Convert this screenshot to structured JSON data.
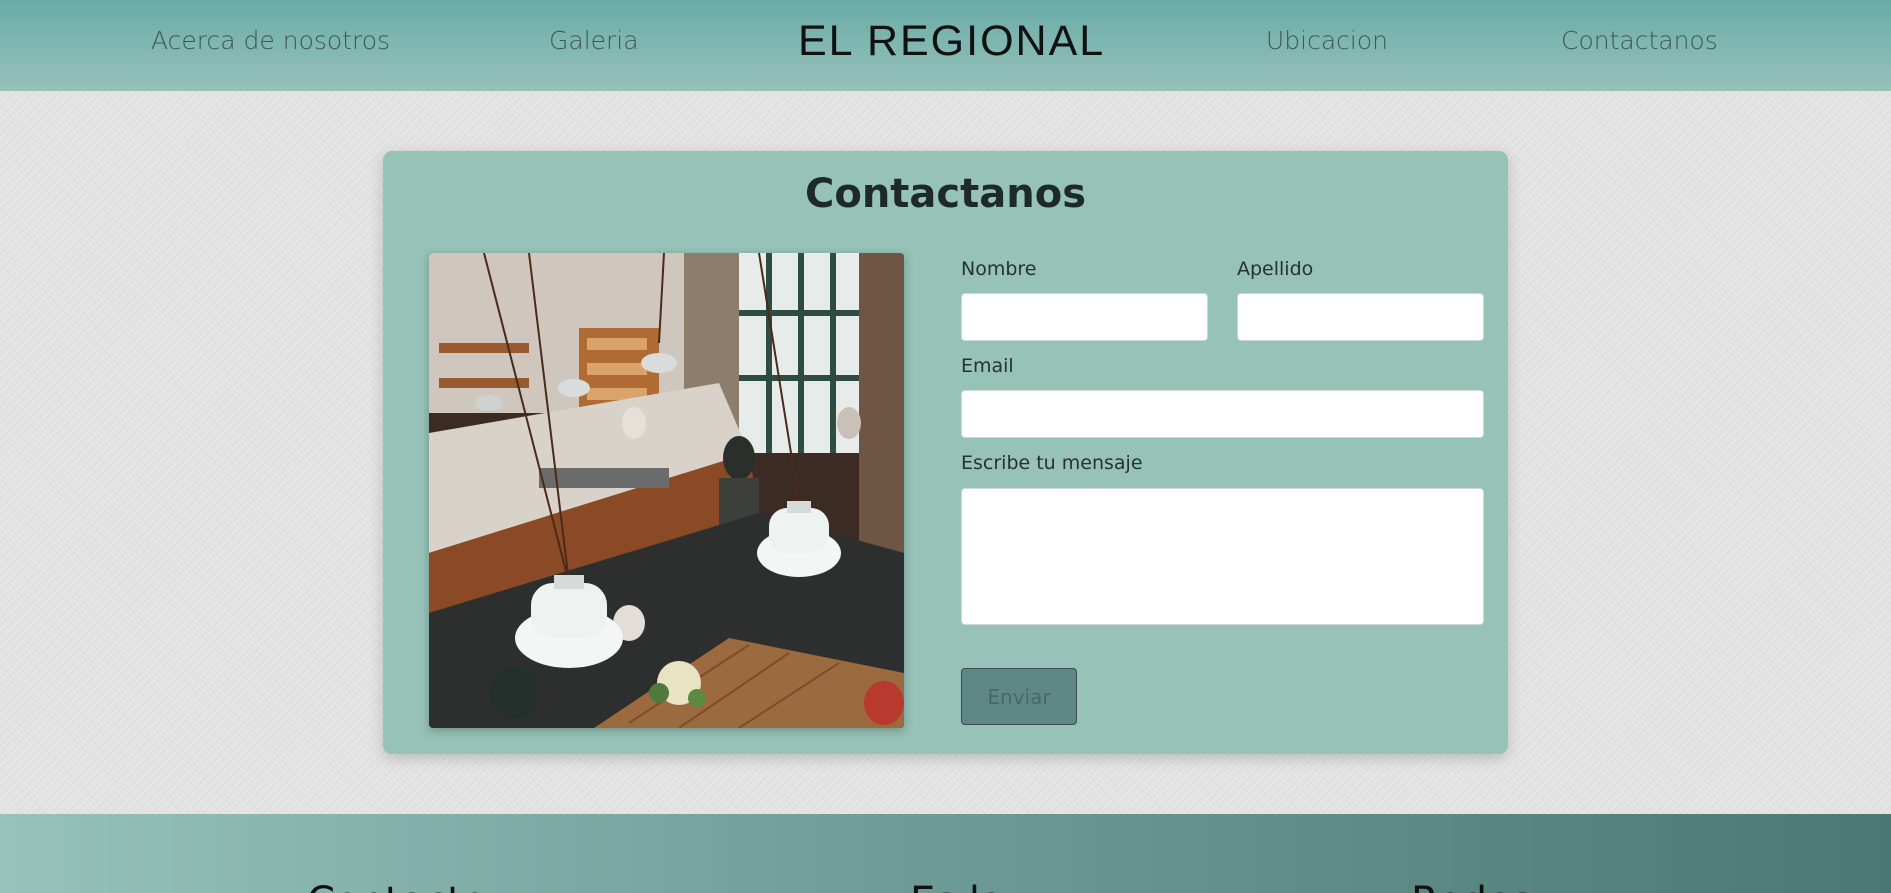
{
  "nav": {
    "left_links": [
      "Acerca de nosotros",
      "Galeria"
    ],
    "brand": "EL REGIONAL",
    "right_links": [
      "Ubicacion",
      "Contactanos"
    ]
  },
  "contact": {
    "title": "Contactanos",
    "photo_alt": "cafe-interior-photo",
    "fields": {
      "first_name_label": "Nombre",
      "first_name_value": "",
      "last_name_label": "Apellido",
      "last_name_value": "",
      "email_label": "Email",
      "email_value": "",
      "message_label": "Escribe tu mensaje",
      "message_value": ""
    },
    "submit_label": "Enviar"
  },
  "footer": {
    "headings": [
      "Contacto",
      "Es la",
      "Redes"
    ]
  },
  "colors": {
    "nav_gradient_top": "#6aaba8",
    "card_bg": "#96c2b8",
    "button_bg": "#5f8785",
    "page_bg": "#e6e6e6"
  }
}
